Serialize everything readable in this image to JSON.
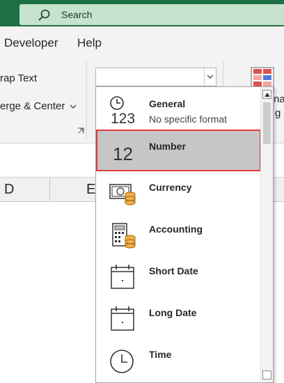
{
  "titlebar": {
    "search_placeholder": "Search",
    "search_icon": "search-icon"
  },
  "menu": {
    "tabs": [
      "Developer",
      "Help"
    ]
  },
  "ribbon": {
    "wrap_text": "rap Text",
    "merge_center": "erge & Center",
    "merge_dropdown_icon": "chevron-down-icon",
    "number_format_value": "",
    "cf_partial_1": "na",
    "cf_partial_2": "g"
  },
  "columns": [
    "D",
    "E"
  ],
  "number_formats": [
    {
      "title": "General",
      "subtitle": "No specific format",
      "icon": "general-123-icon",
      "glyph": "123"
    },
    {
      "title": "Number",
      "subtitle": "",
      "icon": "number-12-icon",
      "glyph": "12",
      "selected": true
    },
    {
      "title": "Currency",
      "subtitle": "",
      "icon": "currency-icon"
    },
    {
      "title": "Accounting",
      "subtitle": "",
      "icon": "accounting-icon"
    },
    {
      "title": "Short Date",
      "subtitle": "",
      "icon": "calendar-icon"
    },
    {
      "title": "Long Date",
      "subtitle": "",
      "icon": "calendar-icon"
    },
    {
      "title": "Time",
      "subtitle": "",
      "icon": "clock-icon"
    }
  ],
  "colors": {
    "titlebar": "#1e7145",
    "search_bg": "#c7e3cf",
    "highlight_border": "#e0393e",
    "selected_bg": "#c6c6c6"
  }
}
